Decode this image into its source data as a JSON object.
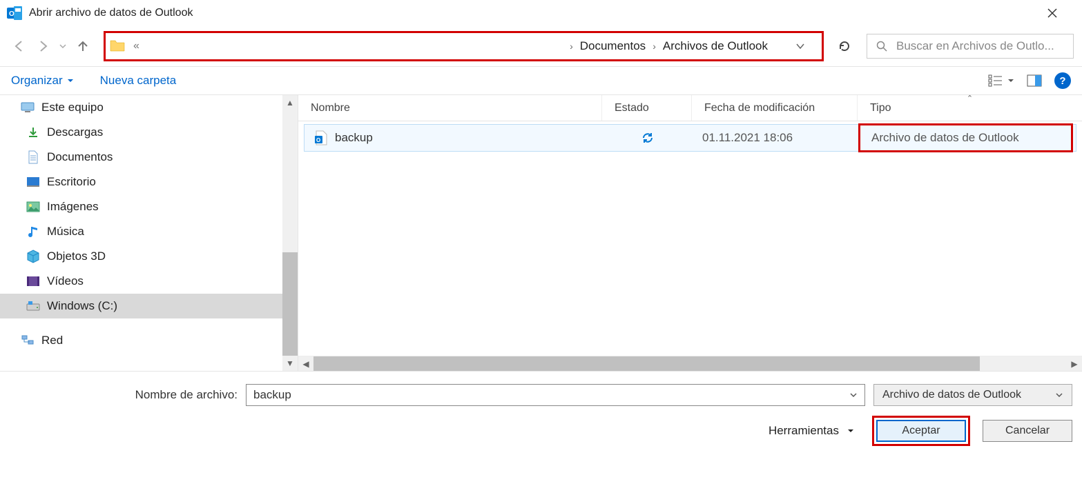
{
  "window": {
    "title": "Abrir archivo de datos de Outlook"
  },
  "address": {
    "crumb1": "Documentos",
    "crumb2": "Archivos de Outlook"
  },
  "search": {
    "placeholder": "Buscar en Archivos de Outlo..."
  },
  "toolbar": {
    "organize": "Organizar",
    "newfolder": "Nueva carpeta"
  },
  "tree": {
    "root": "Este equipo",
    "items": [
      "Descargas",
      "Documentos",
      "Escritorio",
      "Imágenes",
      "Música",
      "Objetos 3D",
      "Vídeos",
      "Windows (C:)"
    ],
    "network": "Red"
  },
  "columns": {
    "name": "Nombre",
    "state": "Estado",
    "date": "Fecha de modificación",
    "type": "Tipo"
  },
  "files": [
    {
      "name": "backup",
      "date": "01.11.2021 18:06",
      "type": "Archivo de datos de Outlook"
    }
  ],
  "bottom": {
    "filename_label": "Nombre de archivo:",
    "filename_value": "backup",
    "filter": "Archivo de datos de Outlook",
    "tools": "Herramientas",
    "accept": "Aceptar",
    "cancel": "Cancelar"
  }
}
